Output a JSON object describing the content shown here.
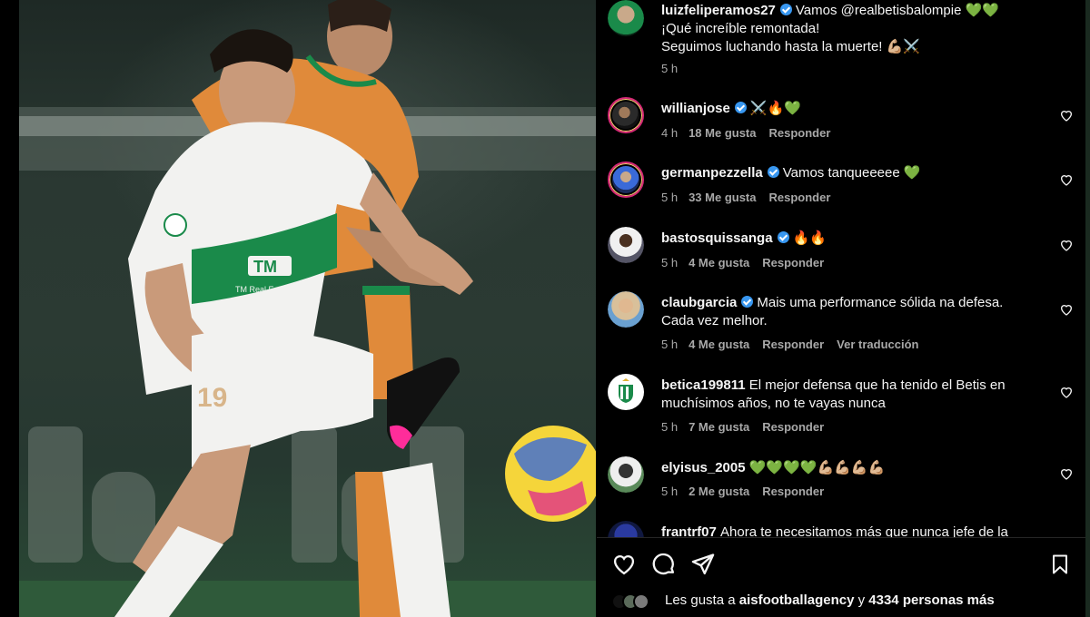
{
  "post": {
    "author": "luizfeliperamos27",
    "caption_line1": "Vamos @realbetisbalompie 💚💚",
    "caption_line2": "¡Qué increíble remontada!",
    "caption_line3": "Seguimos luchando hasta la muerte! 💪🏼⚔️",
    "time": "5 h"
  },
  "comments": [
    {
      "user": "willianjose",
      "verified": true,
      "text": "⚔️🔥💚",
      "time": "4 h",
      "likes": "18 Me gusta",
      "reply": "Responder"
    },
    {
      "user": "germanpezzella",
      "verified": true,
      "text": "Vamos tanqueeeee 💚",
      "time": "5 h",
      "likes": "33 Me gusta",
      "reply": "Responder"
    },
    {
      "user": "bastosquissanga",
      "verified": true,
      "text": "🔥🔥",
      "time": "5 h",
      "likes": "4 Me gusta",
      "reply": "Responder"
    },
    {
      "user": "claubgarcia",
      "verified": true,
      "text": "Mais uma performance sólida na defesa.",
      "text2": "Cada vez melhor.",
      "time": "5 h",
      "likes": "4 Me gusta",
      "reply": "Responder",
      "translate": "Ver traducción"
    },
    {
      "user": "betica199811",
      "verified": false,
      "text": "El mejor defensa que ha tenido el Betis en",
      "text2": "muchísimos años, no te vayas nunca",
      "time": "5 h",
      "likes": "7 Me gusta",
      "reply": "Responder"
    },
    {
      "user": "elyisus_2005",
      "verified": false,
      "text": "💚💚💚💚💪🏼💪🏼💪🏼💪🏼",
      "time": "5 h",
      "likes": "2 Me gusta",
      "reply": "Responder"
    },
    {
      "user": "frantrf07",
      "verified": false,
      "text": "Ahora te necesitamos más que nunca jefe de la"
    }
  ],
  "footer": {
    "likes_prefix": "Les gusta a",
    "likes_user": "aisfootballagency",
    "likes_conj": "y",
    "likes_count": "4334 personas más"
  },
  "photo": {
    "shirt_sponsor": "TM",
    "shirt_sponsor_sub": "TM Real Estate Group",
    "shirt_number": "19"
  },
  "colors": {
    "verified": "#3897f0",
    "secondary_text": "#a8a8a8",
    "elche_green": "#1a8a4a",
    "betis_orange": "#e08a3a"
  }
}
